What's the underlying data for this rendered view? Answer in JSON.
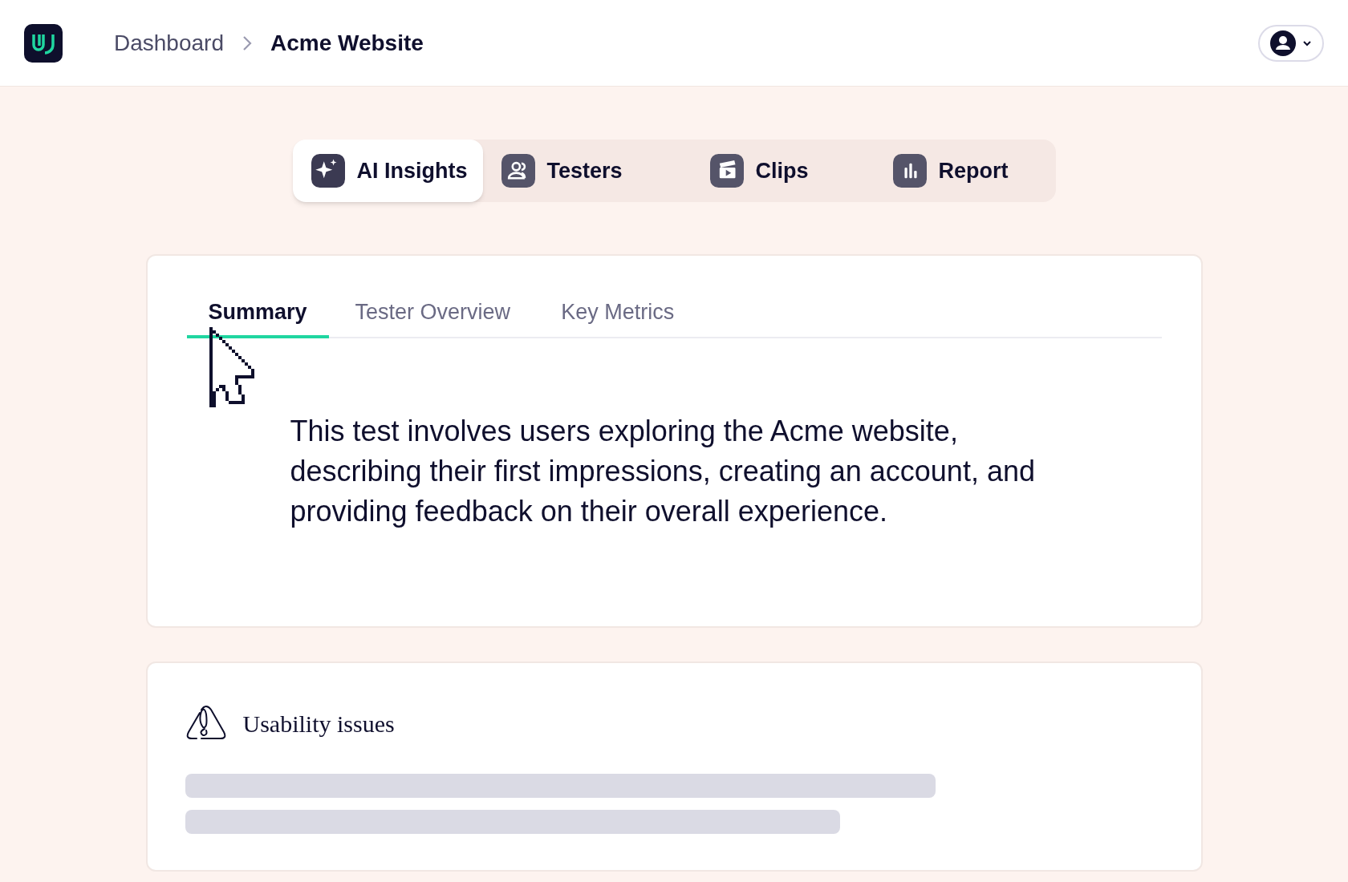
{
  "breadcrumb": [
    {
      "label": "Dashboard",
      "current": false
    },
    {
      "label": "Acme Website",
      "current": true
    }
  ],
  "nav_tabs": [
    {
      "label": "AI Insights",
      "selected": true
    },
    {
      "label": "Testers",
      "selected": false
    },
    {
      "label": "Clips",
      "selected": false
    },
    {
      "label": "Report",
      "selected": false
    }
  ],
  "summary_card": {
    "tabs": [
      {
        "label": "Summary",
        "selected": true
      },
      {
        "label": "Tester Overview",
        "selected": false
      },
      {
        "label": "Key Metrics",
        "selected": false
      }
    ],
    "text": "This test involves users exploring the Acme website, describing their first impressions, creating an account, and providing feedback on their overall experience."
  },
  "issues_card": {
    "title": "Usability issues"
  }
}
